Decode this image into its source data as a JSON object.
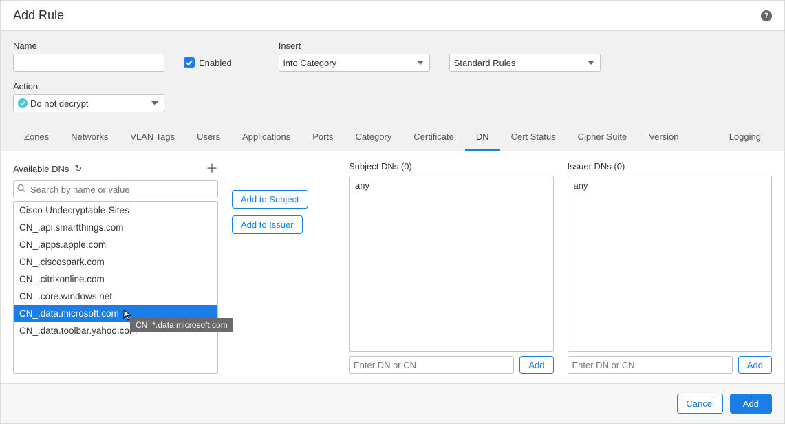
{
  "title": "Add Rule",
  "form": {
    "name_label": "Name",
    "name_value": "",
    "enabled_label": "Enabled",
    "insert_label": "Insert",
    "insert_selected": "into Category",
    "rules_selected": "Standard Rules",
    "action_label": "Action",
    "action_selected": "Do not decrypt"
  },
  "tabs": [
    "Zones",
    "Networks",
    "VLAN Tags",
    "Users",
    "Applications",
    "Ports",
    "Category",
    "Certificate",
    "DN",
    "Cert Status",
    "Cipher Suite",
    "Version"
  ],
  "tab_right": "Logging",
  "active_tab": "DN",
  "available": {
    "label": "Available DNs",
    "search_placeholder": "Search by name or value",
    "items": [
      "Cisco-Undecryptable-Sites",
      "CN_.api.smartthings.com",
      "CN_.apps.apple.com",
      "CN_.ciscospark.com",
      "CN_.citrixonline.com",
      "CN_.core.windows.net",
      "CN_.data.microsoft.com",
      "CN_.data.toolbar.yahoo.com"
    ],
    "selected_index": 6,
    "tooltip_text": "CN=*.data.microsoft.com"
  },
  "buttons": {
    "add_subject": "Add to Subject",
    "add_issuer": "Add to Issuer"
  },
  "subject": {
    "label": "Subject DNs (0)",
    "any": "any",
    "enter_placeholder": "Enter DN or CN",
    "add": "Add"
  },
  "issuer": {
    "label": "Issuer DNs (0)",
    "any": "any",
    "enter_placeholder": "Enter DN or CN",
    "add": "Add"
  },
  "footer": {
    "cancel": "Cancel",
    "add": "Add"
  }
}
